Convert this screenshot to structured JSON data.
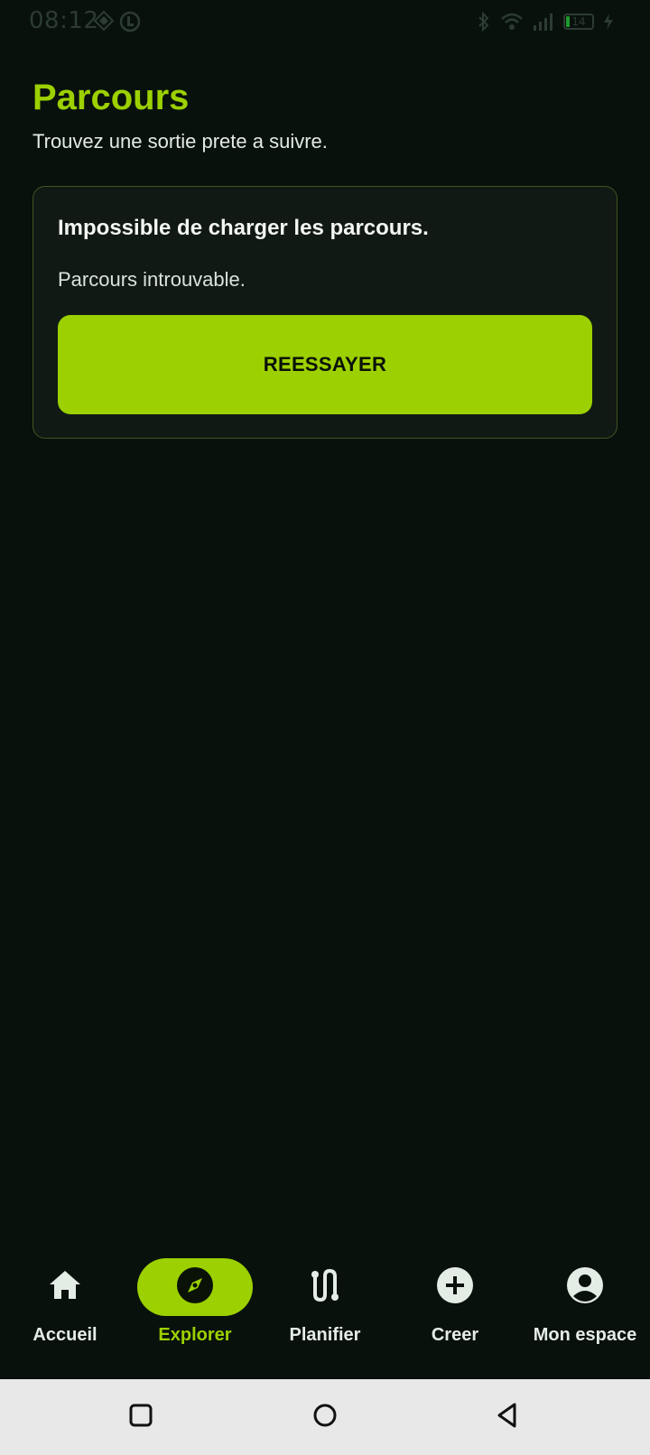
{
  "status_bar": {
    "time": "08:12",
    "battery_level": "14",
    "icons": [
      "diamond-grid-icon",
      "location-badge-icon",
      "bluetooth-icon",
      "wifi-icon",
      "signal-icon",
      "battery-icon",
      "charging-icon"
    ]
  },
  "header": {
    "title": "Parcours",
    "subtitle": "Trouvez une sortie prete a suivre."
  },
  "error_card": {
    "title": "Impossible de charger les parcours.",
    "message": "Parcours introuvable.",
    "retry_label": "REESSAYER"
  },
  "bottom_nav": {
    "items": [
      {
        "label": "Accueil",
        "icon": "home-icon",
        "active": false
      },
      {
        "label": "Explorer",
        "icon": "compass-icon",
        "active": true
      },
      {
        "label": "Planifier",
        "icon": "route-icon",
        "active": false
      },
      {
        "label": "Creer",
        "icon": "add-circle-icon",
        "active": false
      },
      {
        "label": "Mon espace",
        "icon": "account-circle-icon",
        "active": false
      }
    ]
  },
  "system_nav": {
    "buttons": [
      "recents-icon",
      "home-circle-icon",
      "back-triangle-icon"
    ]
  },
  "colors": {
    "background": "#08110c",
    "accent": "#9cd000",
    "card_background": "#111915",
    "card_border": "#3e5620",
    "text_primary": "#f3f6f3",
    "system_bar": "#e8e8e8"
  }
}
